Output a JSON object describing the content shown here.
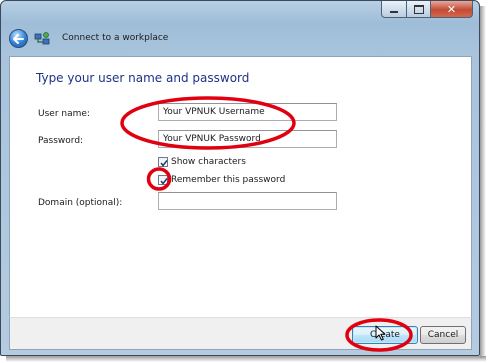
{
  "window": {
    "title": "Connect to a workplace",
    "controls": {
      "minimize": "minimize",
      "maximize": "maximize",
      "close": "✕"
    }
  },
  "page": {
    "heading": "Type your user name and password"
  },
  "form": {
    "username": {
      "label": "User name:",
      "value": "Your VPNUK Username"
    },
    "password": {
      "label": "Password:",
      "value": "Your VPNUK Password"
    },
    "show_characters": {
      "label": "Show characters",
      "checked": true
    },
    "remember_password": {
      "label": "Remember this password",
      "checked": true
    },
    "domain": {
      "label": "Domain (optional):",
      "value": ""
    }
  },
  "buttons": {
    "create": "Create",
    "cancel": "Cancel"
  },
  "annotations": {
    "highlight_color": "#e0000f"
  },
  "icons": {
    "back": "back-arrow-icon",
    "wizard": "network-connection-icon",
    "cursor": "mouse-pointer-icon"
  }
}
